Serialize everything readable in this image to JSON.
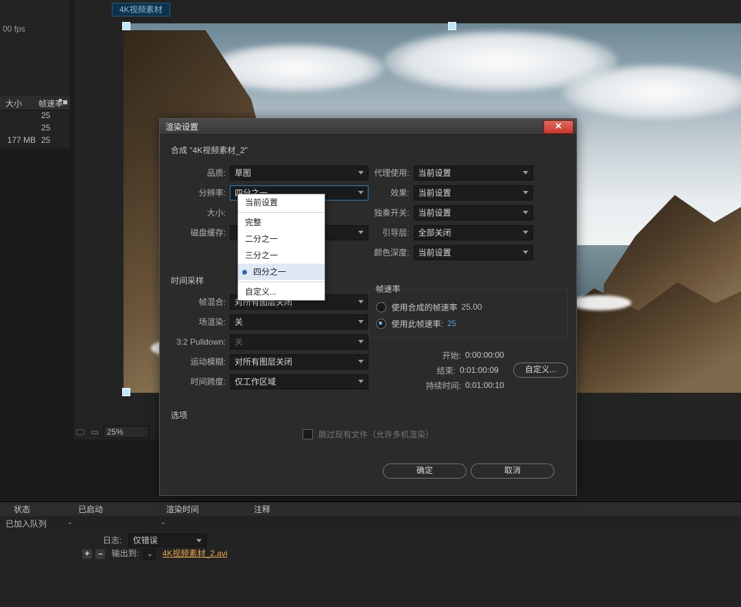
{
  "project_panel": {
    "fps_label": "00 fps",
    "col_size": "大小",
    "col_fps": "帧速率",
    "rows": [
      {
        "size": "",
        "fps": "25"
      },
      {
        "size": "",
        "fps": "25"
      },
      {
        "size": "177 MB",
        "fps": "25"
      }
    ]
  },
  "monitor": {
    "tab": "4K视频素材",
    "zoom": "25%"
  },
  "dialog": {
    "title": "渲染设置",
    "comp_line": "合成 \"4K视频素材_2\"",
    "left": {
      "quality_label": "品质:",
      "quality_value": "草图",
      "resolution_label": "分辨率:",
      "resolution_value": "四分之一",
      "size_label": "大小:",
      "cache_label": "磁盘缓存:"
    },
    "right": {
      "proxy_label": "代理使用:",
      "proxy_value": "当前设置",
      "effects_label": "效果:",
      "effects_value": "当前设置",
      "solo_label": "独奏开关:",
      "solo_value": "当前设置",
      "guides_label": "引导层:",
      "guides_value": "全部关闭",
      "depth_label": "颜色深度:",
      "depth_value": "当前设置"
    },
    "sampling": {
      "title": "时间采样",
      "frame_blend_label": "帧混合:",
      "frame_blend_value": "对所有图层关闭",
      "field_label": "场渲染:",
      "field_value": "关",
      "pulldown_label": "3:2 Pulldown:",
      "pulldown_value": "关",
      "motion_label": "运动模糊:",
      "motion_value": "对所有图层关闭",
      "span_label": "时间跨度:",
      "span_value": "仅工作区域"
    },
    "framerate": {
      "box_title": "帧速率",
      "use_comp": "使用合成的帧速率",
      "comp_val": "25.00",
      "use_this": "使用此帧速率:",
      "this_val": "25"
    },
    "times": {
      "start_label": "开始:",
      "start_val": "0:00:00:00",
      "end_label": "结束:",
      "end_val": "0:01:00:09",
      "dur_label": "持续时间:",
      "dur_val": "0:01:00:10",
      "custom_btn": "自定义..."
    },
    "options": {
      "title": "选项",
      "skip": "跳过现有文件（允许多机渲染）"
    },
    "ok": "确定",
    "cancel": "取消",
    "dropdown": {
      "items": [
        "当前设置",
        "完整",
        "二分之一",
        "三分之一",
        "四分之一",
        "自定义..."
      ],
      "selected": "四分之一"
    }
  },
  "timeline": {
    "col_state": "状态",
    "col_started": "已启动",
    "col_rendertime": "渲染时间",
    "col_comment": "注释",
    "row_state": "已加入队列",
    "log_label": "日志:",
    "log_value": "仅错误",
    "output_label": "输出到:",
    "output_value": "4K视频素材_2.avi"
  }
}
